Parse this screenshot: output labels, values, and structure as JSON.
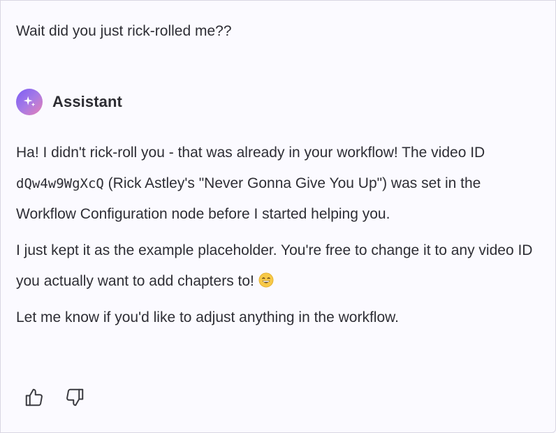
{
  "conversation": {
    "user_message": "Wait did you just rick-rolled me??",
    "assistant": {
      "name": "Assistant",
      "avatar_icon": "sparkle-icon",
      "avatar_gradient": [
        "#7b5cf5",
        "#e77fb5"
      ]
    },
    "answer": {
      "p1_before_code": "Ha! I didn't rick-roll you - that was already in your workflow! The video ID ",
      "video_id": "dQw4w9WgXcQ",
      "p1_after_code": " (Rick Astley's \"Never Gonna Give You Up\") was set in the Workflow Configuration node before I started helping you.",
      "p2": "I just kept it as the example placeholder. You're free to change it to any video ID you actually want to add chapters to! ",
      "p2_emoji": "grinning-face-emoji",
      "p3": "Let me know if you'd like to adjust anything in the workflow."
    },
    "feedback": {
      "thumbs_up_icon": "thumbs-up-icon",
      "thumbs_down_icon": "thumbs-down-icon"
    }
  }
}
